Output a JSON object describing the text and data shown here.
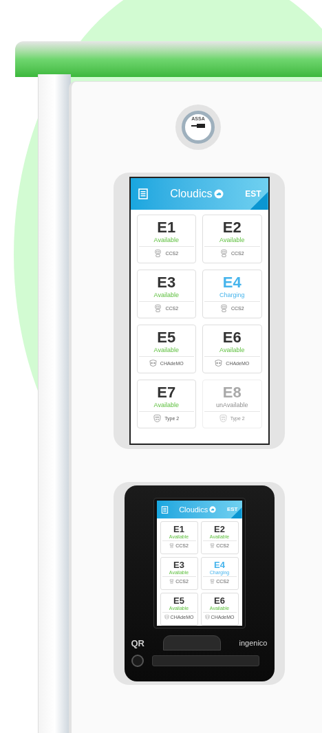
{
  "kiosk": {
    "lock": {
      "label": "ASSA"
    },
    "main_screen": {
      "header": {
        "title": "Cloudics",
        "language": "EST"
      },
      "chargers": [
        {
          "id": "E1",
          "status": "Available",
          "charging": false,
          "disabled": false,
          "connector": {
            "label": "CCS2",
            "kind": "ccs2"
          }
        },
        {
          "id": "E2",
          "status": "Available",
          "charging": false,
          "disabled": false,
          "connector": {
            "label": "CCS2",
            "kind": "ccs2"
          }
        },
        {
          "id": "E3",
          "status": "Available",
          "charging": false,
          "disabled": false,
          "connector": {
            "label": "CCS2",
            "kind": "ccs2"
          }
        },
        {
          "id": "E4",
          "status": "Charging",
          "charging": true,
          "disabled": false,
          "connector": {
            "label": "CCS2",
            "kind": "ccs2"
          }
        },
        {
          "id": "E5",
          "status": "Available",
          "charging": false,
          "disabled": false,
          "connector": {
            "label": "CHAdeMO",
            "kind": "chademo"
          }
        },
        {
          "id": "E6",
          "status": "Available",
          "charging": false,
          "disabled": false,
          "connector": {
            "label": "CHAdeMO",
            "kind": "chademo"
          }
        },
        {
          "id": "E7",
          "status": "Available",
          "charging": false,
          "disabled": false,
          "connector": {
            "label": "Type 2",
            "kind": "type2"
          }
        },
        {
          "id": "E8",
          "status": "unAvailable",
          "charging": false,
          "disabled": true,
          "connector": {
            "label": "Type 2",
            "kind": "type2"
          }
        }
      ]
    },
    "terminal": {
      "screen": {
        "header": {
          "title": "Cloudics",
          "language": "EST"
        },
        "chargers": [
          {
            "id": "E1",
            "status": "Available",
            "charging": false,
            "disabled": false,
            "connector": {
              "label": "CCS2",
              "kind": "ccs2"
            }
          },
          {
            "id": "E2",
            "status": "Available",
            "charging": false,
            "disabled": false,
            "connector": {
              "label": "CCS2",
              "kind": "ccs2"
            }
          },
          {
            "id": "E3",
            "status": "Available",
            "charging": false,
            "disabled": false,
            "connector": {
              "label": "CCS2",
              "kind": "ccs2"
            }
          },
          {
            "id": "E4",
            "status": "Charging",
            "charging": true,
            "disabled": false,
            "connector": {
              "label": "CCS2",
              "kind": "ccs2"
            }
          },
          {
            "id": "E5",
            "status": "Available",
            "charging": false,
            "disabled": false,
            "connector": {
              "label": "CHAdeMO",
              "kind": "chademo"
            }
          },
          {
            "id": "E6",
            "status": "Available",
            "charging": false,
            "disabled": false,
            "connector": {
              "label": "CHAdeMO",
              "kind": "chademo"
            }
          }
        ]
      },
      "qr_label": "QR",
      "brand": "ingenico"
    }
  }
}
